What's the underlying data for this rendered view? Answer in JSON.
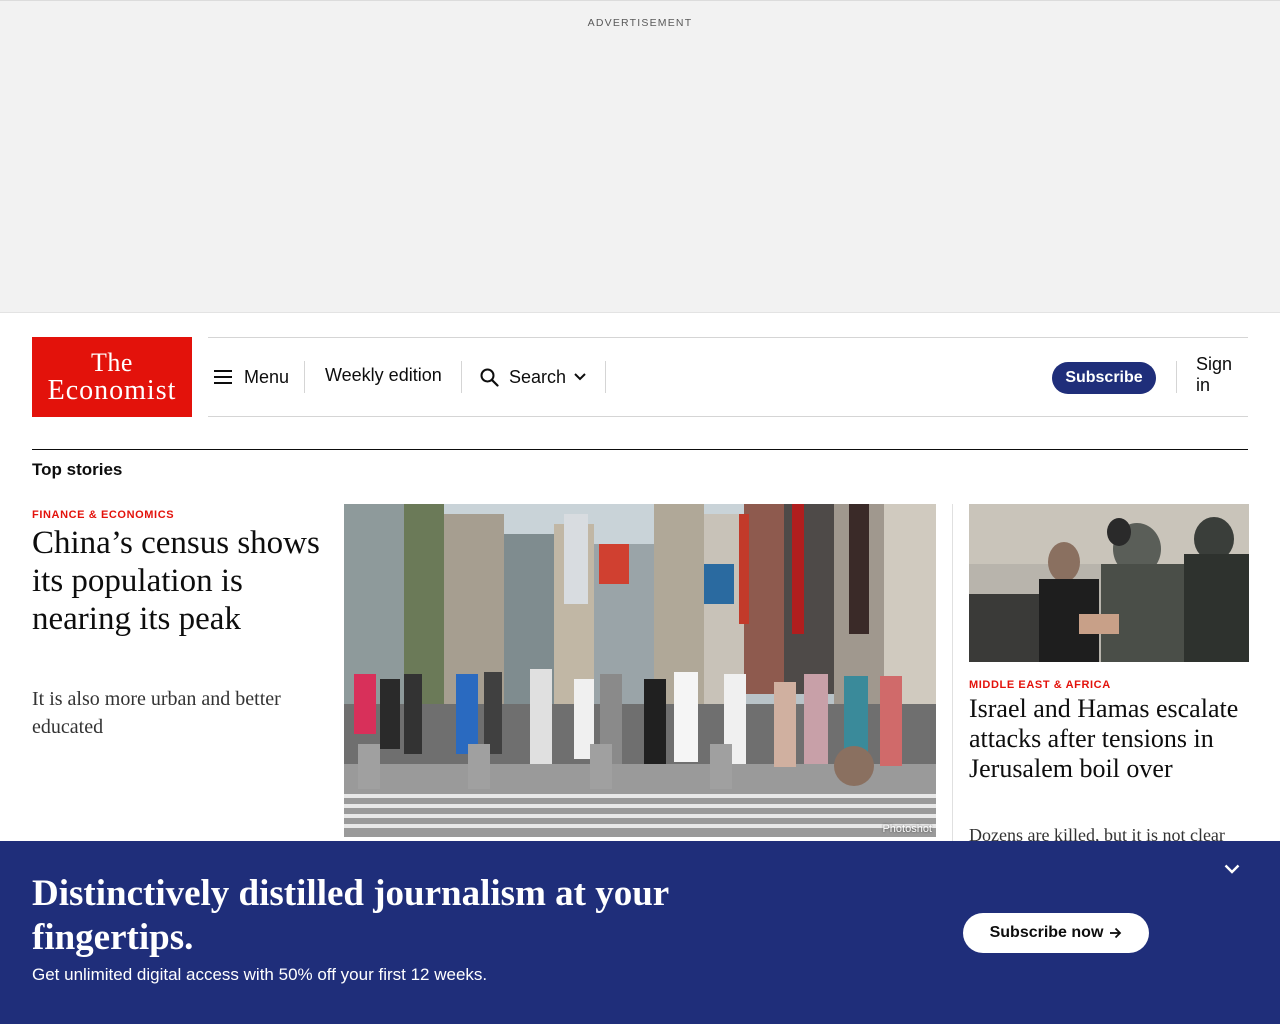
{
  "ad": {
    "label": "ADVERTISEMENT"
  },
  "logo": {
    "line1": "The",
    "line2": "Economist"
  },
  "nav": {
    "menu_label": "Menu",
    "weekly_label": "Weekly edition",
    "search_label": "Search",
    "subscribe_label": "Subscribe",
    "signin_label": "Sign in"
  },
  "section": {
    "title": "Top stories"
  },
  "articles": [
    {
      "kicker": "FINANCE & ECONOMICS",
      "headline": "China’s census shows its population is nearing its peak",
      "rubric": "It is also more urban and better educated",
      "image_credit": "Photoshot"
    },
    {
      "kicker": "MIDDLE EAST & AFRICA",
      "headline": "Israel and Hamas escalate attacks after tensions in Jerusalem boil over",
      "rubric": "Dozens are killed, but it is not clear"
    }
  ],
  "banner": {
    "title": "Distinctively distilled journalism at your fingertips.",
    "subtitle": "Get unlimited digital access with 50% off your first 12 weeks.",
    "button_label": "Subscribe now"
  },
  "colors": {
    "brand_red": "#e3120b",
    "navy": "#1f2e7a"
  },
  "icons": [
    "menu-icon",
    "search-icon",
    "chevron-down-icon",
    "arrow-right-icon",
    "chevron-collapse-icon"
  ]
}
